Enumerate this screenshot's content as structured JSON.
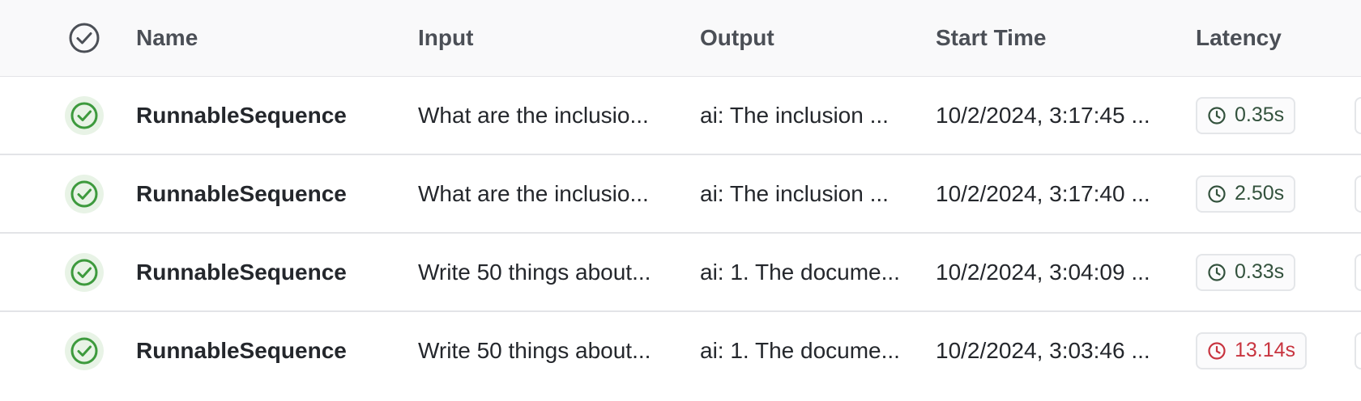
{
  "header": {
    "name": "Name",
    "input": "Input",
    "output": "Output",
    "start_time": "Start Time",
    "latency": "Latency",
    "status_icon": "check-circle-icon"
  },
  "colors": {
    "success": "#3d9a3d",
    "success_bg": "#e8f3e6",
    "latency_normal": "#33523d",
    "latency_slow": "#c8343f"
  },
  "rows": [
    {
      "status": "success",
      "name": "RunnableSequence",
      "input": "What are the inclusio...",
      "output": "ai: The inclusion ...",
      "start_time": "10/2/2024, 3:17:45 ...",
      "latency": "0.35s",
      "latency_level": "normal"
    },
    {
      "status": "success",
      "name": "RunnableSequence",
      "input": "What are the inclusio...",
      "output": "ai: The inclusion ...",
      "start_time": "10/2/2024, 3:17:40 ...",
      "latency": "2.50s",
      "latency_level": "normal"
    },
    {
      "status": "success",
      "name": "RunnableSequence",
      "input": "Write 50 things about...",
      "output": "ai: 1. The docume...",
      "start_time": "10/2/2024, 3:04:09 ...",
      "latency": "0.33s",
      "latency_level": "normal"
    },
    {
      "status": "success",
      "name": "RunnableSequence",
      "input": "Write 50 things about...",
      "output": "ai: 1. The docume...",
      "start_time": "10/2/2024, 3:03:46 ...",
      "latency": "13.14s",
      "latency_level": "slow"
    }
  ]
}
